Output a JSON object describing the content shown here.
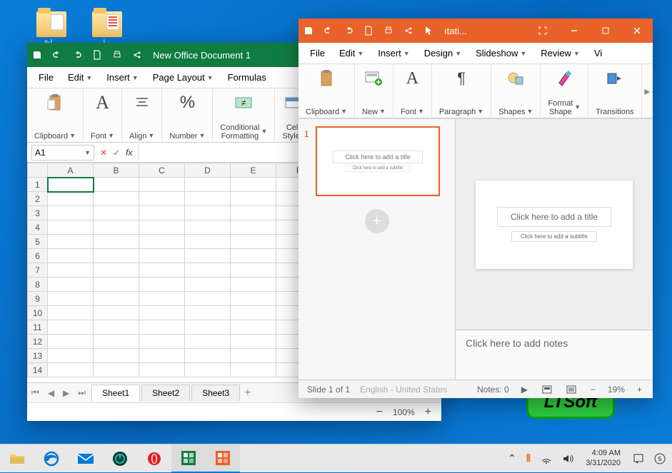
{
  "desktop": {
    "icons": [
      {
        "label": "s-I..."
      },
      {
        "label": "i..."
      }
    ]
  },
  "ltsoft": "LTSoft",
  "spreadsheet": {
    "title": "New Office Document 1",
    "menu": [
      "File",
      "Edit",
      "Insert",
      "Page Layout",
      "Formulas"
    ],
    "ribbon": [
      "Clipboard",
      "Font",
      "Align",
      "Number",
      "Conditional\nFormatting",
      "Cell\nStyles"
    ],
    "cell_ref": "A1",
    "columns": [
      "A",
      "B",
      "C",
      "D",
      "E",
      "F"
    ],
    "rows": [
      "1",
      "2",
      "3",
      "4",
      "5",
      "6",
      "7",
      "8",
      "9",
      "10",
      "11",
      "12",
      "13",
      "14"
    ],
    "sheets": [
      "Sheet1",
      "Sheet2",
      "Sheet3"
    ],
    "active_sheet": 0,
    "zoom": "100%"
  },
  "presentation": {
    "title": "ıtati...",
    "menu": [
      "File",
      "Edit",
      "Insert",
      "Design",
      "Slideshow",
      "Review",
      "Vi"
    ],
    "ribbon": [
      "Clipboard",
      "New",
      "Font",
      "Paragraph",
      "Shapes",
      "Format\nShape",
      "Transitions"
    ],
    "slide_number": "1",
    "thumb_title": "Click here to add a title",
    "thumb_sub": "Click here to add a subtitle",
    "canvas_title": "Click here to add a title",
    "canvas_sub": "Click here to add a subtitle",
    "notes_placeholder": "Click here to add notes",
    "status_slide": "Slide 1 of 1",
    "status_lang": "English - United States",
    "status_notes": "Notes: 0",
    "zoom": "19%"
  },
  "taskbar": {
    "time": "4:09 AM",
    "date": "3/31/2020"
  }
}
